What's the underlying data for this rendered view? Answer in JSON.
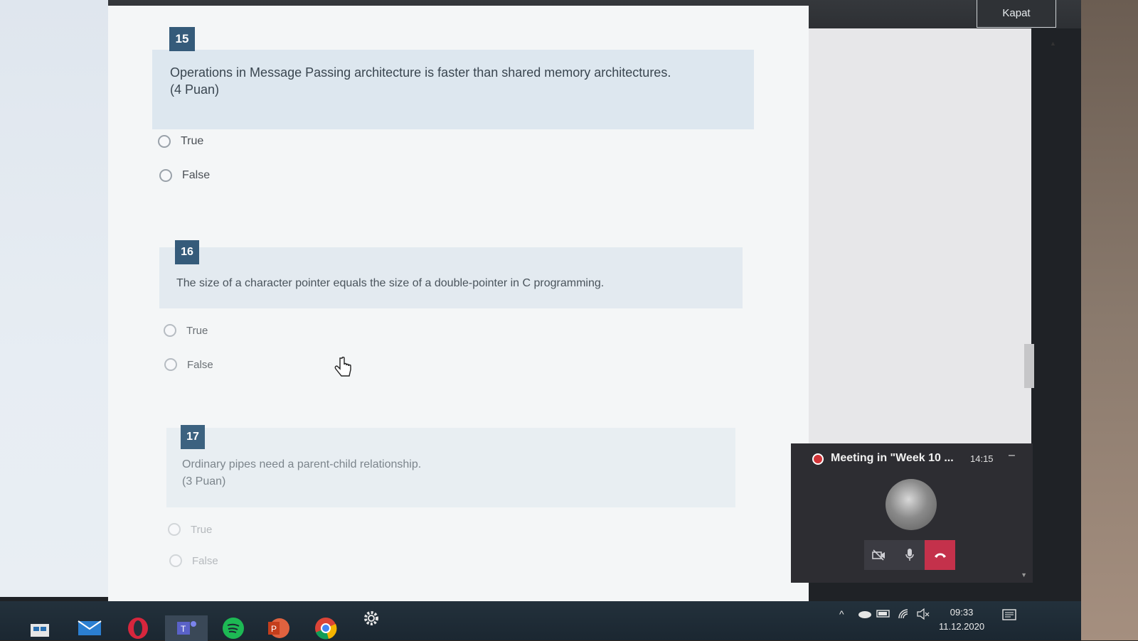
{
  "window": {
    "close_label": "Kapat"
  },
  "questions": [
    {
      "number": "15",
      "text": "Operations in Message Passing architecture is faster than shared memory architectures.",
      "points": "(4 Puan)",
      "options": [
        "True",
        "False"
      ]
    },
    {
      "number": "16",
      "text": "The size of a character pointer equals the size of a double-pointer in C programming.",
      "points": "",
      "options": [
        "True",
        "False"
      ]
    },
    {
      "number": "17",
      "text": "Ordinary pipes need a parent-child relationship.",
      "points": "(3 Puan)",
      "options": [
        "True",
        "False"
      ]
    }
  ],
  "meeting": {
    "title": "Meeting in \"Week 10 ...",
    "elapsed": "14:15"
  },
  "taskbar": {
    "apps": [
      "store-icon",
      "mail-icon",
      "opera-icon",
      "teams-icon",
      "spotify-icon",
      "powerpoint-icon",
      "chrome-icon",
      "settings-icon"
    ],
    "time": "09:33",
    "date": "11.12.2020"
  },
  "colors": {
    "question_number_bg": "#355b7a",
    "question_block_bg": "#dde7ef",
    "meeting_bg": "#2d2d32",
    "hangup": "#c4314b",
    "taskbar": "#1f2b35"
  }
}
